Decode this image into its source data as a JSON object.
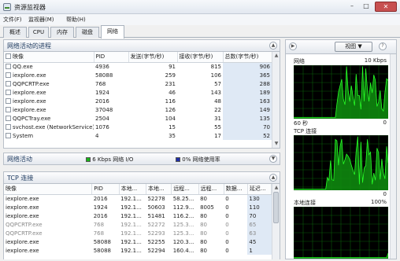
{
  "window": {
    "title": "资源监视器",
    "minimize": "–",
    "maximize": "□",
    "close": "✕"
  },
  "menu": [
    "文件(F)",
    "监视器(M)",
    "帮助(H)"
  ],
  "tabs": [
    "概述",
    "CPU",
    "内存",
    "磁盘",
    "网络"
  ],
  "active_tab": "网络",
  "processes": {
    "title": "网络活动的进程",
    "columns": [
      "映像",
      "PID",
      "发送(字节/秒)",
      "接收(字节/秒)",
      "总数(字节/秒)"
    ],
    "rows": [
      [
        "QQ.exe",
        "4936",
        "91",
        "815",
        "906"
      ],
      [
        "iexplore.exe",
        "58088",
        "259",
        "106",
        "365"
      ],
      [
        "QQPCRTP.exe",
        "768",
        "231",
        "57",
        "288"
      ],
      [
        "iexplore.exe",
        "1924",
        "46",
        "143",
        "189"
      ],
      [
        "iexplore.exe",
        "2016",
        "116",
        "48",
        "163"
      ],
      [
        "iexplore.exe",
        "37048",
        "126",
        "22",
        "149"
      ],
      [
        "QQPCTray.exe",
        "2504",
        "104",
        "31",
        "135"
      ],
      [
        "svchost.exe (NetworkService)",
        "1076",
        "15",
        "55",
        "70"
      ],
      [
        "System",
        "4",
        "35",
        "17",
        "52"
      ]
    ]
  },
  "network_activity": {
    "title": "网络活动",
    "io_label": "6 Kbps 网络 I/O",
    "usage_label": "0% 网络使用率",
    "io_color": "#18b418",
    "usage_color": "#1f2ea8"
  },
  "tcp": {
    "title": "TCP 连接",
    "columns": [
      "映像",
      "PID",
      "本地...",
      "本地...",
      "远程...",
      "远程...",
      "数据...",
      "延迟..."
    ],
    "rows": [
      [
        "iexplore.exe",
        "2016",
        "192.1...",
        "52278",
        "58.25...",
        "80",
        "0",
        "130"
      ],
      [
        "iexplore.exe",
        "1924",
        "192.1...",
        "50603",
        "112.9...",
        "8005",
        "0",
        "110"
      ],
      [
        "iexplore.exe",
        "2016",
        "192.1...",
        "51481",
        "116.2...",
        "80",
        "0",
        "70"
      ],
      [
        "QQPCRTP.exe",
        "768",
        "192.1...",
        "52272",
        "125.3...",
        "80",
        "0",
        "65"
      ],
      [
        "QQPCRTP.exe",
        "768",
        "192.1...",
        "52293",
        "125.3...",
        "80",
        "0",
        "63"
      ],
      [
        "iexplore.exe",
        "58088",
        "192.1...",
        "52255",
        "120.3...",
        "80",
        "0",
        "45"
      ],
      [
        "iexplore.exe",
        "58088",
        "192.1...",
        "52294",
        "160.4...",
        "80",
        "0",
        "1"
      ]
    ],
    "dimmed_rows": [
      3,
      4
    ]
  },
  "right_panel": {
    "view_button": "视图",
    "graphs": [
      {
        "label": "网络",
        "value": "10 Kbps",
        "footer_left": "60 秒",
        "footer_right": "0"
      },
      {
        "label": "TCP 连接",
        "value": "",
        "footer_left": "",
        "footer_right": "0"
      },
      {
        "label": "本地连接",
        "value": "100%",
        "footer_left": "",
        "footer_right": ""
      }
    ]
  },
  "graph_colors": {
    "grid": "#0a5a0a",
    "line": "#27ff27",
    "fill": "#0f8f0f"
  }
}
